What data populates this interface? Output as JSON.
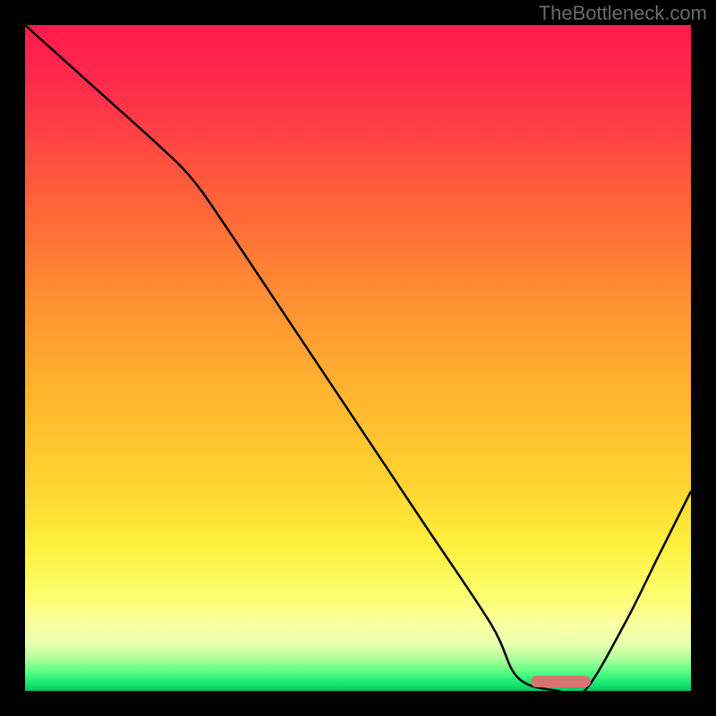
{
  "watermark": "TheBottleneck.com",
  "chart_data": {
    "type": "line",
    "title": "",
    "xlabel": "",
    "ylabel": "",
    "xlim": [
      0,
      100
    ],
    "ylim": [
      0,
      100
    ],
    "grid": false,
    "series": [
      {
        "name": "curve",
        "color": "#000000",
        "x": [
          0,
          10,
          20,
          25,
          30,
          40,
          50,
          60,
          70,
          74,
          80,
          84,
          90,
          95,
          100
        ],
        "y": [
          100,
          91,
          82,
          77,
          70,
          55,
          40,
          25,
          10,
          2,
          0,
          0,
          10,
          20,
          30
        ]
      }
    ],
    "marker": {
      "name": "optimal-range",
      "x_start": 76,
      "x_end": 85,
      "y": 1.5,
      "color": "#d67570"
    },
    "background_gradient": {
      "top": "#ff1a4d",
      "mid": "#ffd631",
      "bottom": "#08c563"
    }
  }
}
